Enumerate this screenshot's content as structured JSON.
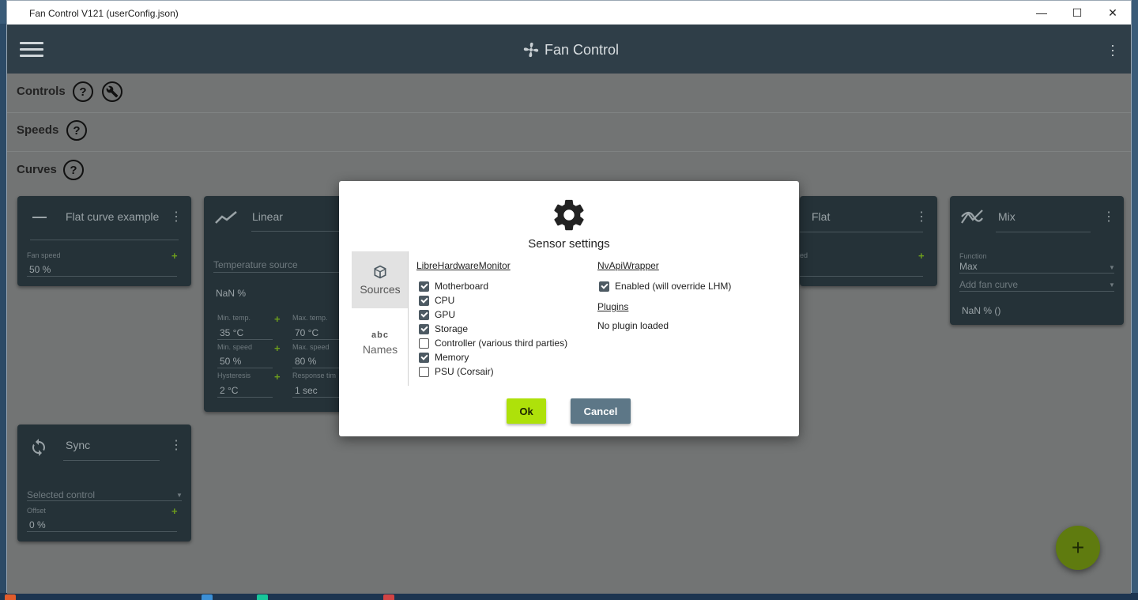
{
  "window": {
    "title": "Fan Control V121 (userConfig.json)",
    "minimize_glyph": "—",
    "maximize_glyph": "☐",
    "close_glyph": "✕"
  },
  "appbar": {
    "title": "Fan Control",
    "menu_icon": "hamburger-icon",
    "logo_icon": "fan-icon",
    "more_icon": "more-vert-icon"
  },
  "sections": {
    "controls": "Controls",
    "speeds": "Speeds",
    "curves": "Curves",
    "help_glyph": "?"
  },
  "cards": {
    "flat_example": {
      "title": "Flat curve example",
      "field_label": "Fan speed",
      "field_value": "50 %"
    },
    "linear": {
      "title": "Linear",
      "temp_source": "Temperature source",
      "readout": "NaN %",
      "min_temp_label": "Min. temp.",
      "min_temp": "35 °C",
      "max_temp_label": "Max. temp.",
      "max_temp": "70 °C",
      "min_speed_label": "Min. speed",
      "min_speed": "50 %",
      "max_speed_label": "Max. speed",
      "max_speed": "80 %",
      "hysteresis_label": "Hysteresis",
      "hysteresis": "2 °C",
      "response_label": "Response tim",
      "response": "1 sec"
    },
    "flat": {
      "title": "Flat",
      "field_label": "ed"
    },
    "mix": {
      "title": "Mix",
      "function_label": "Function",
      "function_value": "Max",
      "add_curve": "Add fan curve",
      "readout": "NaN % ()"
    },
    "sync": {
      "title": "Sync",
      "selected_control": "Selected control",
      "offset_label": "Offset",
      "offset_value": "0 %"
    },
    "plus_glyph": "+",
    "kebab_glyph": "⋮",
    "caret_glyph": "▼"
  },
  "fab": {
    "glyph": "+"
  },
  "dialog": {
    "title": "Sensor settings",
    "tabs": [
      {
        "label": "Sources",
        "icon": "cube-icon"
      },
      {
        "label": "Names",
        "icon": "abc-icon",
        "glyph": "abc"
      }
    ],
    "lhm": {
      "title": "LibreHardwareMonitor",
      "items": [
        {
          "label": "Motherboard",
          "checked": true
        },
        {
          "label": "CPU",
          "checked": true
        },
        {
          "label": "GPU",
          "checked": true
        },
        {
          "label": "Storage",
          "checked": true
        },
        {
          "label": "Controller (various third parties)",
          "checked": false
        },
        {
          "label": "Memory",
          "checked": true
        },
        {
          "label": "PSU (Corsair)",
          "checked": false
        }
      ]
    },
    "nvapi": {
      "title": "NvApiWrapper",
      "enabled_label": "Enabled (will override LHM)",
      "enabled": true
    },
    "plugins": {
      "title": "Plugins",
      "status": "No plugin loaded"
    },
    "ok_label": "Ok",
    "cancel_label": "Cancel"
  },
  "colors": {
    "appbar": "#2f3e48",
    "card": "#253238",
    "ok_button": "#aee10a",
    "cancel_button": "#5d7787",
    "fab": "#5f7b0f"
  }
}
